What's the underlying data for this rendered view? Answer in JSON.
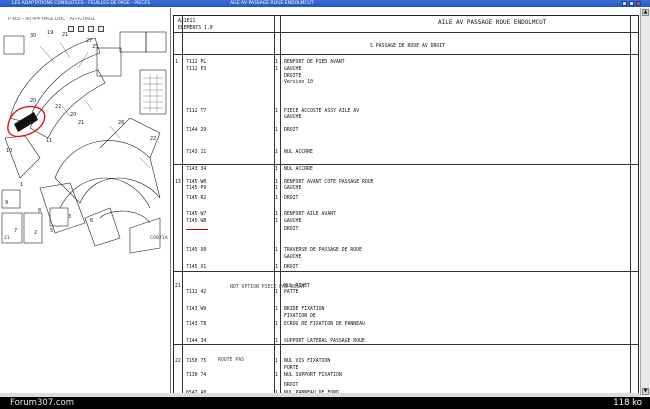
{
  "window": {
    "title": "LES ADAPTATIONS CONSULTEES - FEUILLES DE PAGE - PIECES",
    "title_right": "AILE AV PASSAGE ROUE ENDOLMCUT"
  },
  "diagram": {
    "toolbar_text": "P 405 - 40 PPP PAGE DOC - AFFICHAGE",
    "labels": [
      "30",
      "19",
      "21",
      "27",
      "25",
      "20",
      "22",
      "20",
      "21",
      "26",
      "22",
      "11",
      "10",
      "1",
      "9",
      "8",
      "3",
      "6",
      "7",
      "2",
      "5"
    ],
    "footer_code": "21",
    "ref_code": "C0871A"
  },
  "content": {
    "header_left": "A21E11",
    "header_left2": "ELEMENTS 1.0",
    "header_right": "AILE AV PASSAGE ROUE ENDOLMCUT",
    "subheader": "S PASSAGE DE ROUE AV DROIT",
    "rows": [
      {
        "num": "1",
        "ref": "7112 PL",
        "qty": "1",
        "desc": "RENFORT DE PIED AVANT"
      },
      {
        "num": "",
        "ref": "7112 P3",
        "qty": "1",
        "desc": "GAUCHE"
      },
      {
        "num": "",
        "ref": "",
        "qty": "",
        "desc": "DROITE"
      },
      {
        "num": "",
        "ref": "",
        "qty": "",
        "desc": "Version 10"
      },
      {
        "num": "",
        "ref": "7112 T7",
        "qty": "1",
        "desc": "PIECE ACCOSTE ASSY AILE AV"
      },
      {
        "num": "",
        "ref": "",
        "qty": "",
        "desc": "GAUCHE"
      },
      {
        "num": "",
        "ref": "7144 29",
        "qty": "1",
        "desc": "DROIT"
      },
      {
        "num": "",
        "ref": "7143 11",
        "qty": "1",
        "desc": "NUL ACCRRE"
      },
      {
        "num": "",
        "ref": "7143 34",
        "qty": "1",
        "desc": "NUL ACCRRE"
      },
      {
        "num": "13",
        "ref": "7145 W0",
        "qty": "1",
        "desc": "RENFORT AVANT COTE PASSAGE ROUE"
      },
      {
        "num": "",
        "ref": "7145 P9",
        "qty": "1",
        "desc": "GAUCHE"
      },
      {
        "num": "",
        "ref": "7145 R2",
        "qty": "1",
        "desc": "DROIT"
      },
      {
        "num": "",
        "ref": "7145 W7",
        "qty": "1",
        "desc": "RENFORT AILE AVANT"
      },
      {
        "num": "",
        "ref": "7145 W8",
        "qty": "1",
        "desc": "GAUCHE"
      },
      {
        "num": "",
        "ref": "",
        "qty": "",
        "desc": "DROIT"
      },
      {
        "num": "",
        "ref": "7145 X0",
        "qty": "1",
        "desc": "TRAVERSE DE PASSAGE DE ROUE"
      },
      {
        "num": "",
        "ref": "",
        "qty": "",
        "desc": "GAUCHE"
      },
      {
        "num": "",
        "ref": "7145 X1",
        "qty": "1",
        "desc": "DROIT"
      },
      {
        "num": "21",
        "ref": "",
        "qty": "",
        "desc": "NUL RIVET"
      },
      {
        "num": "",
        "ref": "7112 42",
        "qty": "1",
        "desc": "PATTE"
      },
      {
        "num": "",
        "ref": "7143 W9",
        "qty": "1",
        "desc": "BRIDE FIXATION"
      },
      {
        "num": "",
        "ref": "",
        "qty": "",
        "desc": "FIXATION DE"
      },
      {
        "num": "",
        "ref": "7143 T8",
        "qty": "1",
        "desc": "ECROU DE FIXATION DE PANNEAU"
      },
      {
        "num": "",
        "ref": "7144 34",
        "qty": "1",
        "desc": "SUPPORT LATERAL PASSAGE ROUE"
      },
      {
        "num": "22",
        "ref": "7150 75",
        "qty": "1",
        "desc": "NUL VIS FIXATION"
      },
      {
        "num": "",
        "ref": "",
        "qty": "",
        "desc": "PORTE"
      },
      {
        "num": "",
        "ref": "7130 74",
        "qty": "1",
        "desc": "NUL SUPPORT FIXATION"
      },
      {
        "num": "",
        "ref": "",
        "qty": "",
        "desc": "DROIT"
      },
      {
        "num": "",
        "ref": "6547 A8",
        "qty": "1",
        "desc": "NUL PANNEAU DE FOND"
      }
    ],
    "side_notes": [
      "NOT OPTION PIECE PAS ODINT",
      "ROUTE PAS"
    ]
  },
  "status": {
    "forum": "Forum307.com",
    "file_size": "118 ko"
  }
}
